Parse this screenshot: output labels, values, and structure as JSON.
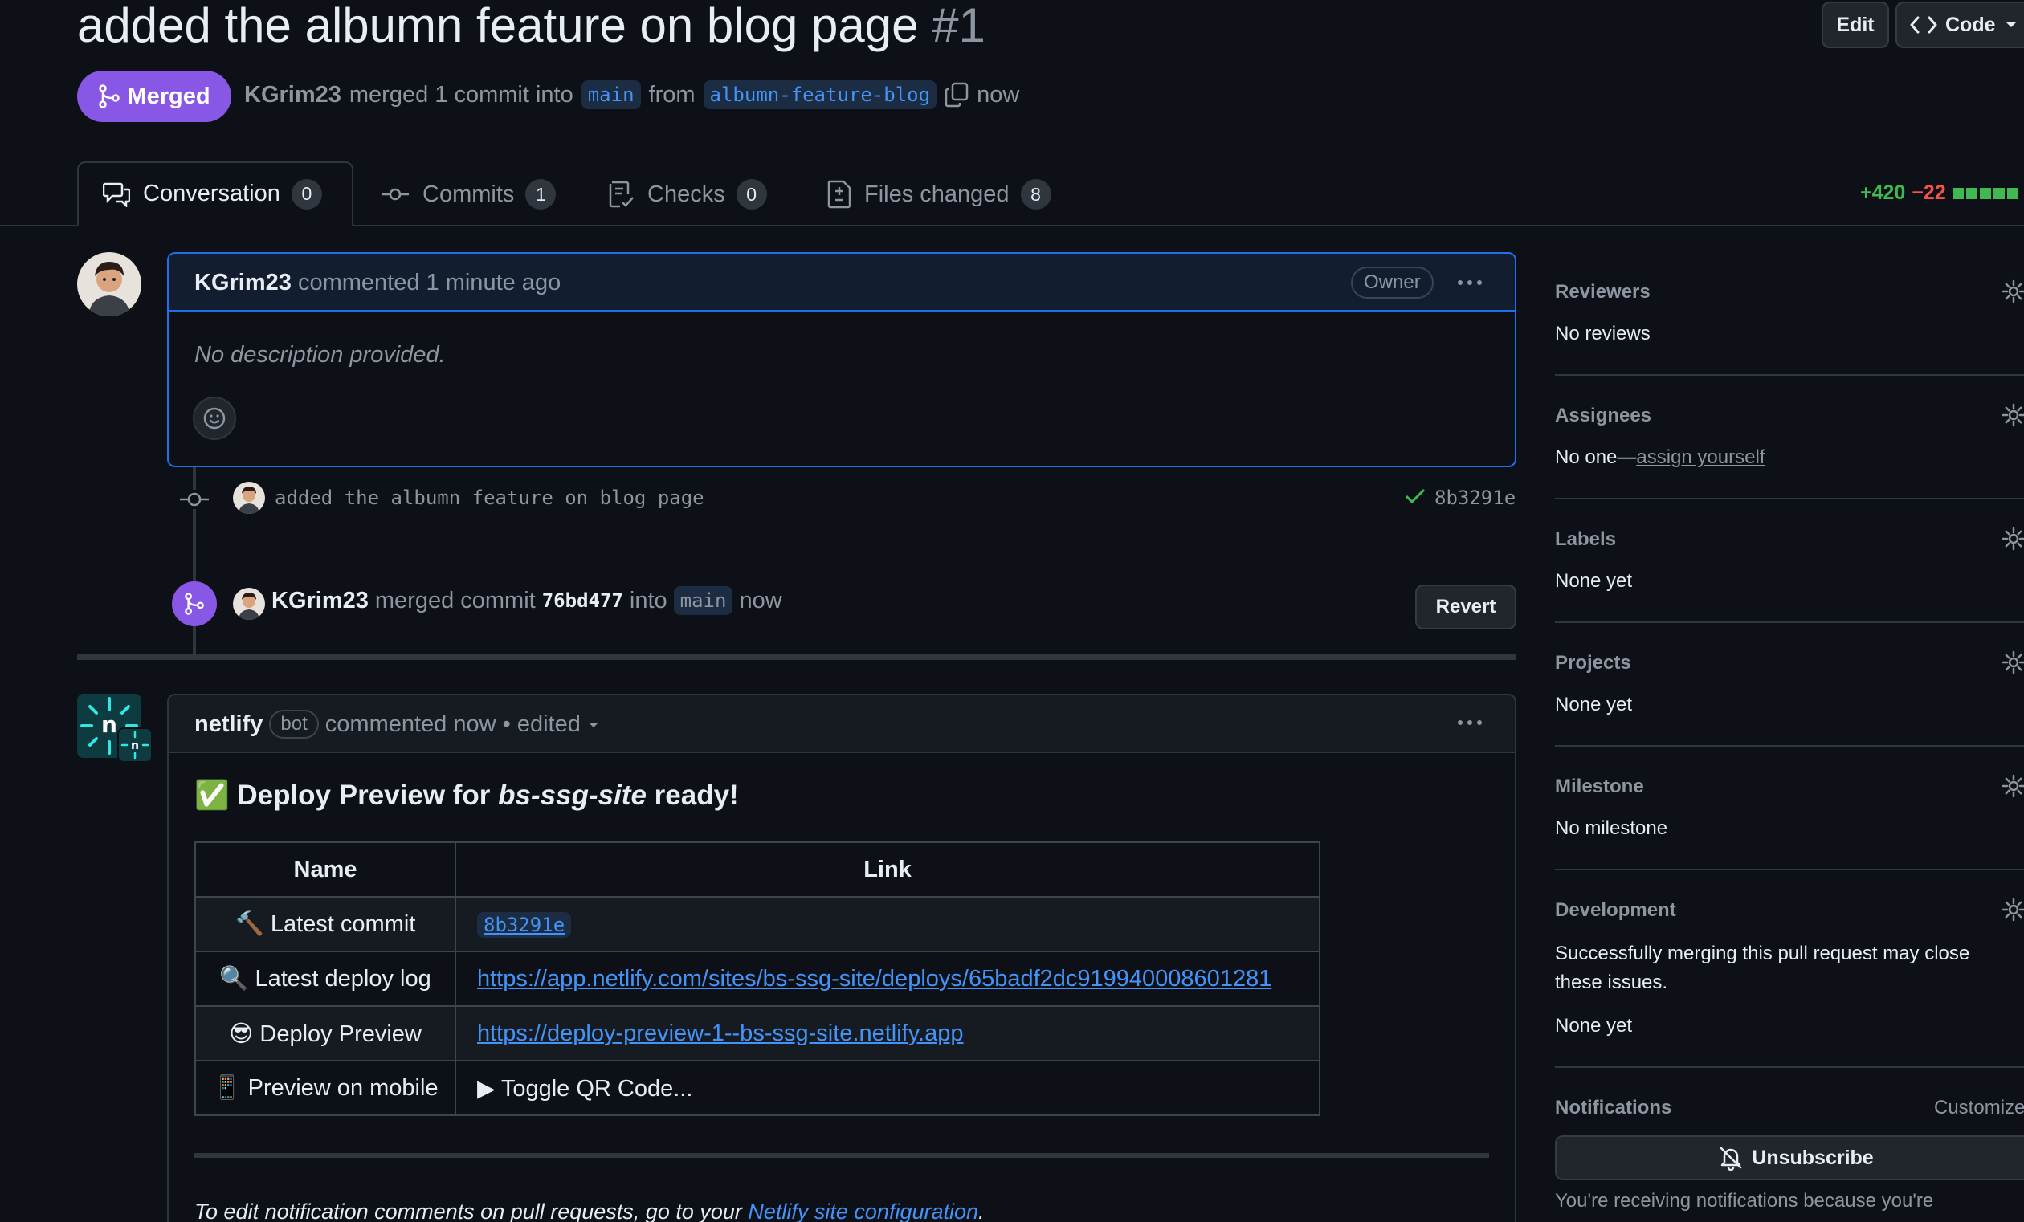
{
  "header": {
    "title": "added the albumn feature on blog page",
    "number": "#1",
    "edit_label": "Edit",
    "code_label": "Code"
  },
  "status": {
    "badge": "Merged",
    "author": "KGrim23",
    "merged_text": "merged 1 commit into",
    "base_branch": "main",
    "from_text": "from",
    "head_branch": "albumn-feature-blog",
    "time": "now"
  },
  "tabs": [
    {
      "label": "Conversation",
      "count": "0"
    },
    {
      "label": "Commits",
      "count": "1"
    },
    {
      "label": "Checks",
      "count": "0"
    },
    {
      "label": "Files changed",
      "count": "8"
    }
  ],
  "diffstat": {
    "additions": "+420",
    "deletions": "−22"
  },
  "comment": {
    "author": "KGrim23",
    "meta": "commented 1 minute ago",
    "role": "Owner",
    "body": "No description provided."
  },
  "commit_event": {
    "message": "added the albumn feature on blog page",
    "sha": "8b3291e"
  },
  "merge_event": {
    "author": "KGrim23",
    "text1": "merged commit",
    "sha": "76bd477",
    "text2": "into",
    "branch": "main",
    "time": "now",
    "revert_label": "Revert"
  },
  "bot_comment": {
    "author": "netlify",
    "bot_label": "bot",
    "meta": "commented now • edited",
    "heading_check": "✅",
    "heading_pre": "Deploy Preview for ",
    "heading_site": "bs-ssg-site",
    "heading_post": " ready!",
    "table_headers": [
      "Name",
      "Link"
    ],
    "rows": [
      {
        "emoji": "🔨",
        "name": "Latest commit",
        "value": "8b3291e"
      },
      {
        "emoji": "🔍",
        "name": "Latest deploy log",
        "value": "https://app.netlify.com/sites/bs-ssg-site/deploys/65badf2dc919940008601281"
      },
      {
        "emoji": "😎",
        "name": "Deploy Preview",
        "value": "https://deploy-preview-1--bs-ssg-site.netlify.app"
      },
      {
        "emoji": "📱",
        "name": "Preview on mobile",
        "value": "▶ Toggle QR Code..."
      }
    ],
    "footer_pre": "To edit notification comments on pull requests, go to your ",
    "footer_link": "Netlify site configuration",
    "footer_post": "."
  },
  "sidebar": {
    "reviewers": {
      "title": "Reviewers",
      "value": "No reviews"
    },
    "assignees": {
      "title": "Assignees",
      "value_pre": "No one—",
      "value_link": "assign yourself"
    },
    "labels": {
      "title": "Labels",
      "value": "None yet"
    },
    "projects": {
      "title": "Projects",
      "value": "None yet"
    },
    "milestone": {
      "title": "Milestone",
      "value": "No milestone"
    },
    "development": {
      "title": "Development",
      "desc": "Successfully merging this pull request may close these issues.",
      "value": "None yet"
    },
    "notifications": {
      "title": "Notifications",
      "customize": "Customize",
      "unsubscribe_label": "Unsubscribe",
      "reason": "You're receiving notifications because you're"
    }
  },
  "colors": {
    "accent_merged": "#8957e5",
    "link": "#4493f8",
    "success": "#3fb950",
    "danger": "#f85149",
    "bg": "#0d1117"
  }
}
